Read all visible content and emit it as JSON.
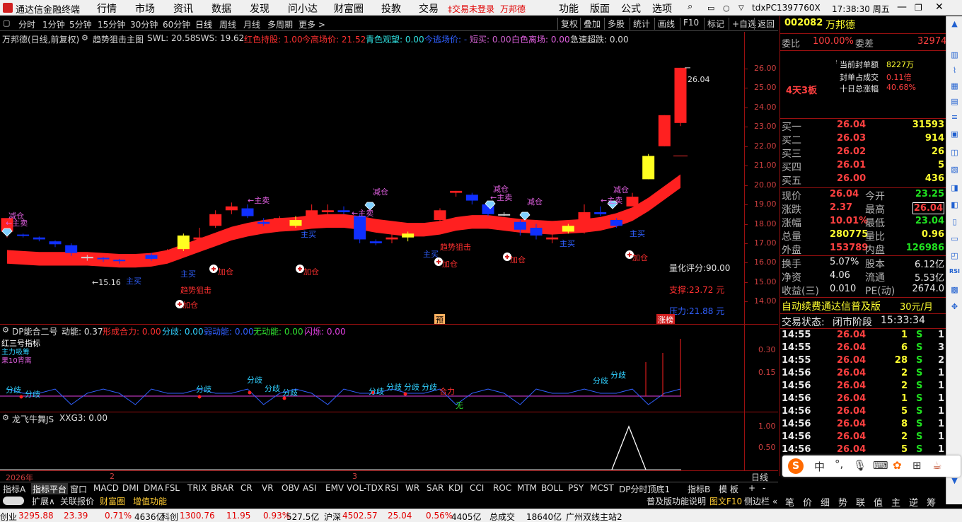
{
  "menu": {
    "app_title": "通达信金融终端",
    "items": [
      "行情",
      "市场",
      "资讯",
      "数据",
      "发现",
      "问小达",
      "财富圈",
      "投教",
      "交易"
    ],
    "trade_warning": "‡交易未登录",
    "stock_short": "万邦德",
    "right_items": [
      "功能",
      "版面",
      "公式",
      "选项"
    ],
    "host": "tdxPC1397760X",
    "time": "17:38:30 周五"
  },
  "periods": [
    "分时",
    "1分钟",
    "5分钟",
    "15分钟",
    "30分钟",
    "60分钟",
    "日线",
    "周线",
    "月线",
    "多周期",
    "更多 >"
  ],
  "selected_period": "日线",
  "tools": [
    "复权",
    "叠加",
    "多股",
    "统计",
    "画线",
    "F10",
    "标记",
    "+自选",
    "返回"
  ],
  "main_header": {
    "name": "万邦德(日线,前复权)",
    "indicator": "趋势狙击主图",
    "swl": "SWL: 20.58",
    "sws": "SWS: 19.62",
    "hold": "红色持股: 1.00",
    "high_price": "今高场价: 21.52",
    "watch": "青色观望: 0.00",
    "leave_price": "今逃场价: -",
    "short_sell": "短买: 0.00",
    "white_leave": "白色离场: 0.00",
    "super_drop": "急速超跌: 0.00"
  },
  "main_yticks": [
    "26.00",
    "25.00",
    "24.00",
    "23.00",
    "22.00",
    "21.00",
    "20.00",
    "19.00",
    "18.00",
    "17.00",
    "16.00",
    "15.00",
    "14.00"
  ],
  "annotations": {
    "max_label": "26.04",
    "min_label": "←15.16",
    "score": "量化评分:90.00",
    "support": "支撑:23.72 元",
    "pressure": "压力:21.88 元",
    "marker_yu": "预",
    "marker_zb": "涨榜",
    "zhumai": "←主卖",
    "zhumai2": "主买",
    "jiancang": "减仓",
    "jiacang": "加仓",
    "qushi": "趋势狙击"
  },
  "pane2": {
    "header": "DP能合二号",
    "dongneng": "动能: 0.37",
    "xingcheng": "形成合力: 0.00",
    "fenqi": "分歧: 0.00",
    "ruodongneng": "弱动能: 0.00",
    "wudongneng": "无动能: 0.00",
    "shanshuo": "闪烁: 0.00",
    "yticks": [
      "0.30",
      "0.15"
    ],
    "legend": [
      "红三号指标",
      "主力吸筹",
      "果10背离"
    ],
    "fenqi_label": "分歧",
    "heli_label": "合力",
    "wu_label": "无"
  },
  "pane3": {
    "header": "龙飞牛舞JS",
    "xxg3": "XXG3: 0.00",
    "yticks": [
      "1.00",
      "0.50"
    ]
  },
  "xaxis": {
    "labels": [
      "2026年",
      "2",
      "3"
    ],
    "mode": "日线"
  },
  "quote": {
    "code": "002082",
    "name": "万邦德",
    "weibi_label": "委比",
    "weibi": "100.00%",
    "weicha_label": "委差",
    "weicha": "32974",
    "seal_amount_label": "当前封单额",
    "seal_amount": "8227万",
    "seal_ratio_label": "封单占成交",
    "seal_ratio": "0.11倍",
    "ten_day_label": "十日总涨幅",
    "ten_day": "40.68%",
    "boards": "4天3板",
    "bids": [
      {
        "label": "买一",
        "price": "26.04",
        "vol": "31593"
      },
      {
        "label": "买二",
        "price": "26.03",
        "vol": "914"
      },
      {
        "label": "买三",
        "price": "26.02",
        "vol": "26"
      },
      {
        "label": "买四",
        "price": "26.01",
        "vol": "5"
      },
      {
        "label": "买五",
        "price": "26.00",
        "vol": "436"
      }
    ],
    "stats": [
      {
        "l1": "现价",
        "v1": "26.04",
        "l2": "今开",
        "v2": "23.25"
      },
      {
        "l1": "涨跌",
        "v1": "2.37",
        "l2": "最高",
        "v2": "26.04"
      },
      {
        "l1": "涨幅",
        "v1": "10.01%",
        "l2": "最低",
        "v2": "23.04"
      },
      {
        "l1": "总量",
        "v1": "280775",
        "l2": "量比",
        "v2": "0.96"
      },
      {
        "l1": "外盘",
        "v1": "153789",
        "l2": "内盘",
        "v2": "126986"
      }
    ],
    "stats2": [
      {
        "l1": "换手",
        "v1": "5.07%",
        "l2": "股本",
        "v2": "6.12亿"
      },
      {
        "l1": "净资",
        "v1": "4.06",
        "l2": "流通",
        "v2": "5.53亿"
      },
      {
        "l1": "收益(三)",
        "v1": "0.010",
        "l2": "PE(动)",
        "v2": "2674.0"
      }
    ],
    "promo": "自动续费通达信普及版",
    "promo_price": "30元/月",
    "trade_status_label": "交易状态:",
    "trade_status": "闭市阶段",
    "trade_time": "15:33:34",
    "ticks": [
      {
        "t": "14:55",
        "p": "26.04",
        "v": "1",
        "s": "S",
        "n": "1"
      },
      {
        "t": "14:55",
        "p": "26.04",
        "v": "6",
        "s": "S",
        "n": "3"
      },
      {
        "t": "14:55",
        "p": "26.04",
        "v": "28",
        "s": "S",
        "n": "2"
      },
      {
        "t": "14:56",
        "p": "26.04",
        "v": "2",
        "s": "S",
        "n": "1"
      },
      {
        "t": "14:56",
        "p": "26.04",
        "v": "2",
        "s": "S",
        "n": "1"
      },
      {
        "t": "14:56",
        "p": "26.04",
        "v": "1",
        "s": "S",
        "n": "1"
      },
      {
        "t": "14:56",
        "p": "26.04",
        "v": "5",
        "s": "S",
        "n": "1"
      },
      {
        "t": "14:56",
        "p": "26.04",
        "v": "8",
        "s": "S",
        "n": "1"
      },
      {
        "t": "14:56",
        "p": "26.04",
        "v": "2",
        "s": "S",
        "n": "1"
      },
      {
        "t": "14:56",
        "p": "26.04",
        "v": "5",
        "s": "S",
        "n": "1"
      }
    ]
  },
  "tabs": [
    "指标A",
    "指标平台",
    "窗口",
    "MACD",
    "DMI",
    "DMA",
    "FSL",
    "TRIX",
    "BRAR",
    "CR",
    "VR",
    "OBV",
    "ASI",
    "EMV",
    "VOL-TDX",
    "RSI",
    "WR",
    "SAR",
    "KDJ",
    "CCI",
    "ROC",
    "MTM",
    "BOLL",
    "PSY",
    "MCST",
    "DP分时顶底1",
    "指标B",
    "模 板",
    "+",
    "-"
  ],
  "tabs2": [
    "扩展∧",
    "关联报价",
    "财富圈",
    "增值功能"
  ],
  "tabs2_right": [
    "普及版功能说明",
    "图文F10",
    "侧边栏 «"
  ],
  "rtabs": [
    "笔",
    "价",
    "细",
    "势",
    "联",
    "值",
    "主",
    "逆",
    "筹"
  ],
  "status": [
    {
      "name": "创业",
      "v": "3295.88",
      "c": "23.39",
      "p": "0.71%",
      "a": "4636亿"
    },
    {
      "name": "科创",
      "v": "1300.76",
      "c": "11.95",
      "p": "0.93%",
      "a": "527.5亿"
    },
    {
      "name": "沪深",
      "v": "4502.57",
      "c": "25.04",
      "p": "0.56%",
      "a": "4405亿"
    }
  ],
  "status_extra": {
    "total_label": "总成交",
    "total": "18640亿",
    "server": "广州双线主站2"
  },
  "chart_data": {
    "type": "candlestick",
    "title": "万邦德(日线,前复权)",
    "ylim": [
      13.5,
      26.8
    ],
    "candles": [
      [
        17.6,
        18.3,
        17.3,
        18.1
      ],
      [
        17.45,
        17.4,
        17.3,
        17.5
      ],
      [
        17.3,
        17.2,
        17.1,
        17.35
      ],
      [
        17.1,
        16.95,
        16.8,
        17.15
      ],
      [
        16.9,
        16.5,
        16.35,
        17.0
      ],
      [
        16.3,
        16.25,
        16.1,
        16.4
      ],
      [
        16.25,
        16.2,
        16.05,
        16.3
      ],
      [
        16.15,
        16.1,
        15.95,
        16.2
      ],
      [
        16.25,
        16.4,
        16.0,
        16.45
      ],
      [
        16.4,
        16.2,
        16.1,
        16.5
      ],
      [
        16.3,
        16.6,
        16.2,
        16.7
      ],
      [
        16.7,
        17.4,
        16.6,
        17.5
      ],
      [
        17.2,
        17.3,
        17.0,
        17.8
      ],
      [
        17.9,
        18.5,
        17.8,
        18.7
      ],
      [
        18.7,
        18.9,
        18.5,
        19.1
      ],
      [
        18.8,
        18.4,
        18.3,
        19.0
      ],
      [
        18.1,
        18.0,
        17.9,
        18.3
      ],
      [
        18.0,
        18.3,
        17.9,
        18.4
      ],
      [
        18.2,
        17.9,
        17.8,
        18.4
      ],
      [
        18.4,
        18.7,
        18.3,
        19.0
      ],
      [
        18.6,
        18.7,
        18.4,
        19.0
      ],
      [
        18.7,
        18.6,
        18.5,
        18.9
      ],
      [
        18.4,
        17.2,
        17.0,
        18.5
      ],
      [
        17.1,
        17.0,
        16.9,
        17.2
      ],
      [
        17.2,
        17.3,
        17.0,
        17.5
      ],
      [
        17.5,
        17.3,
        17.1,
        17.6
      ],
      [
        17.5,
        17.7,
        17.4,
        18.0
      ],
      [
        18.2,
        18.7,
        18.1,
        18.8
      ],
      [
        19.6,
        19.7,
        19.4,
        19.7
      ],
      [
        19.5,
        19.2,
        19.0,
        19.6
      ],
      [
        19.0,
        18.5,
        18.4,
        19.1
      ],
      [
        18.5,
        18.5,
        18.4,
        18.6
      ],
      [
        18.1,
        17.7,
        17.4,
        18.2
      ],
      [
        17.8,
        17.4,
        17.2,
        18.0
      ],
      [
        17.2,
        17.3,
        17.0,
        17.7
      ],
      [
        17.6,
        17.9,
        17.5,
        18.0
      ],
      [
        17.6,
        18.6,
        17.5,
        19.0
      ],
      [
        18.6,
        18.5,
        18.4,
        18.9
      ],
      [
        18.2,
        17.9,
        17.8,
        18.3
      ],
      [
        18.9,
        19.4,
        18.9,
        19.6
      ],
      [
        20.3,
        21.5,
        20.3,
        21.6
      ],
      [
        22.0,
        23.6,
        22.0,
        23.6
      ],
      [
        23.2,
        26.04,
        23.04,
        26.04
      ]
    ],
    "ma_ribbon": [
      16.3,
      16.25,
      16.2,
      16.2,
      16.2,
      16.2,
      16.15,
      16.1,
      16.1,
      16.15,
      16.3,
      16.6,
      16.9,
      17.2,
      17.5,
      17.7,
      17.85,
      17.95,
      18.0,
      18.1,
      18.15,
      18.15,
      18.05,
      17.9,
      17.8,
      17.7,
      17.7,
      17.8,
      18.0,
      18.1,
      18.1,
      18.0,
      17.9,
      17.85,
      17.8,
      17.85,
      17.9,
      18.0,
      18.2,
      18.5,
      19.0,
      19.6,
      20.2
    ]
  }
}
